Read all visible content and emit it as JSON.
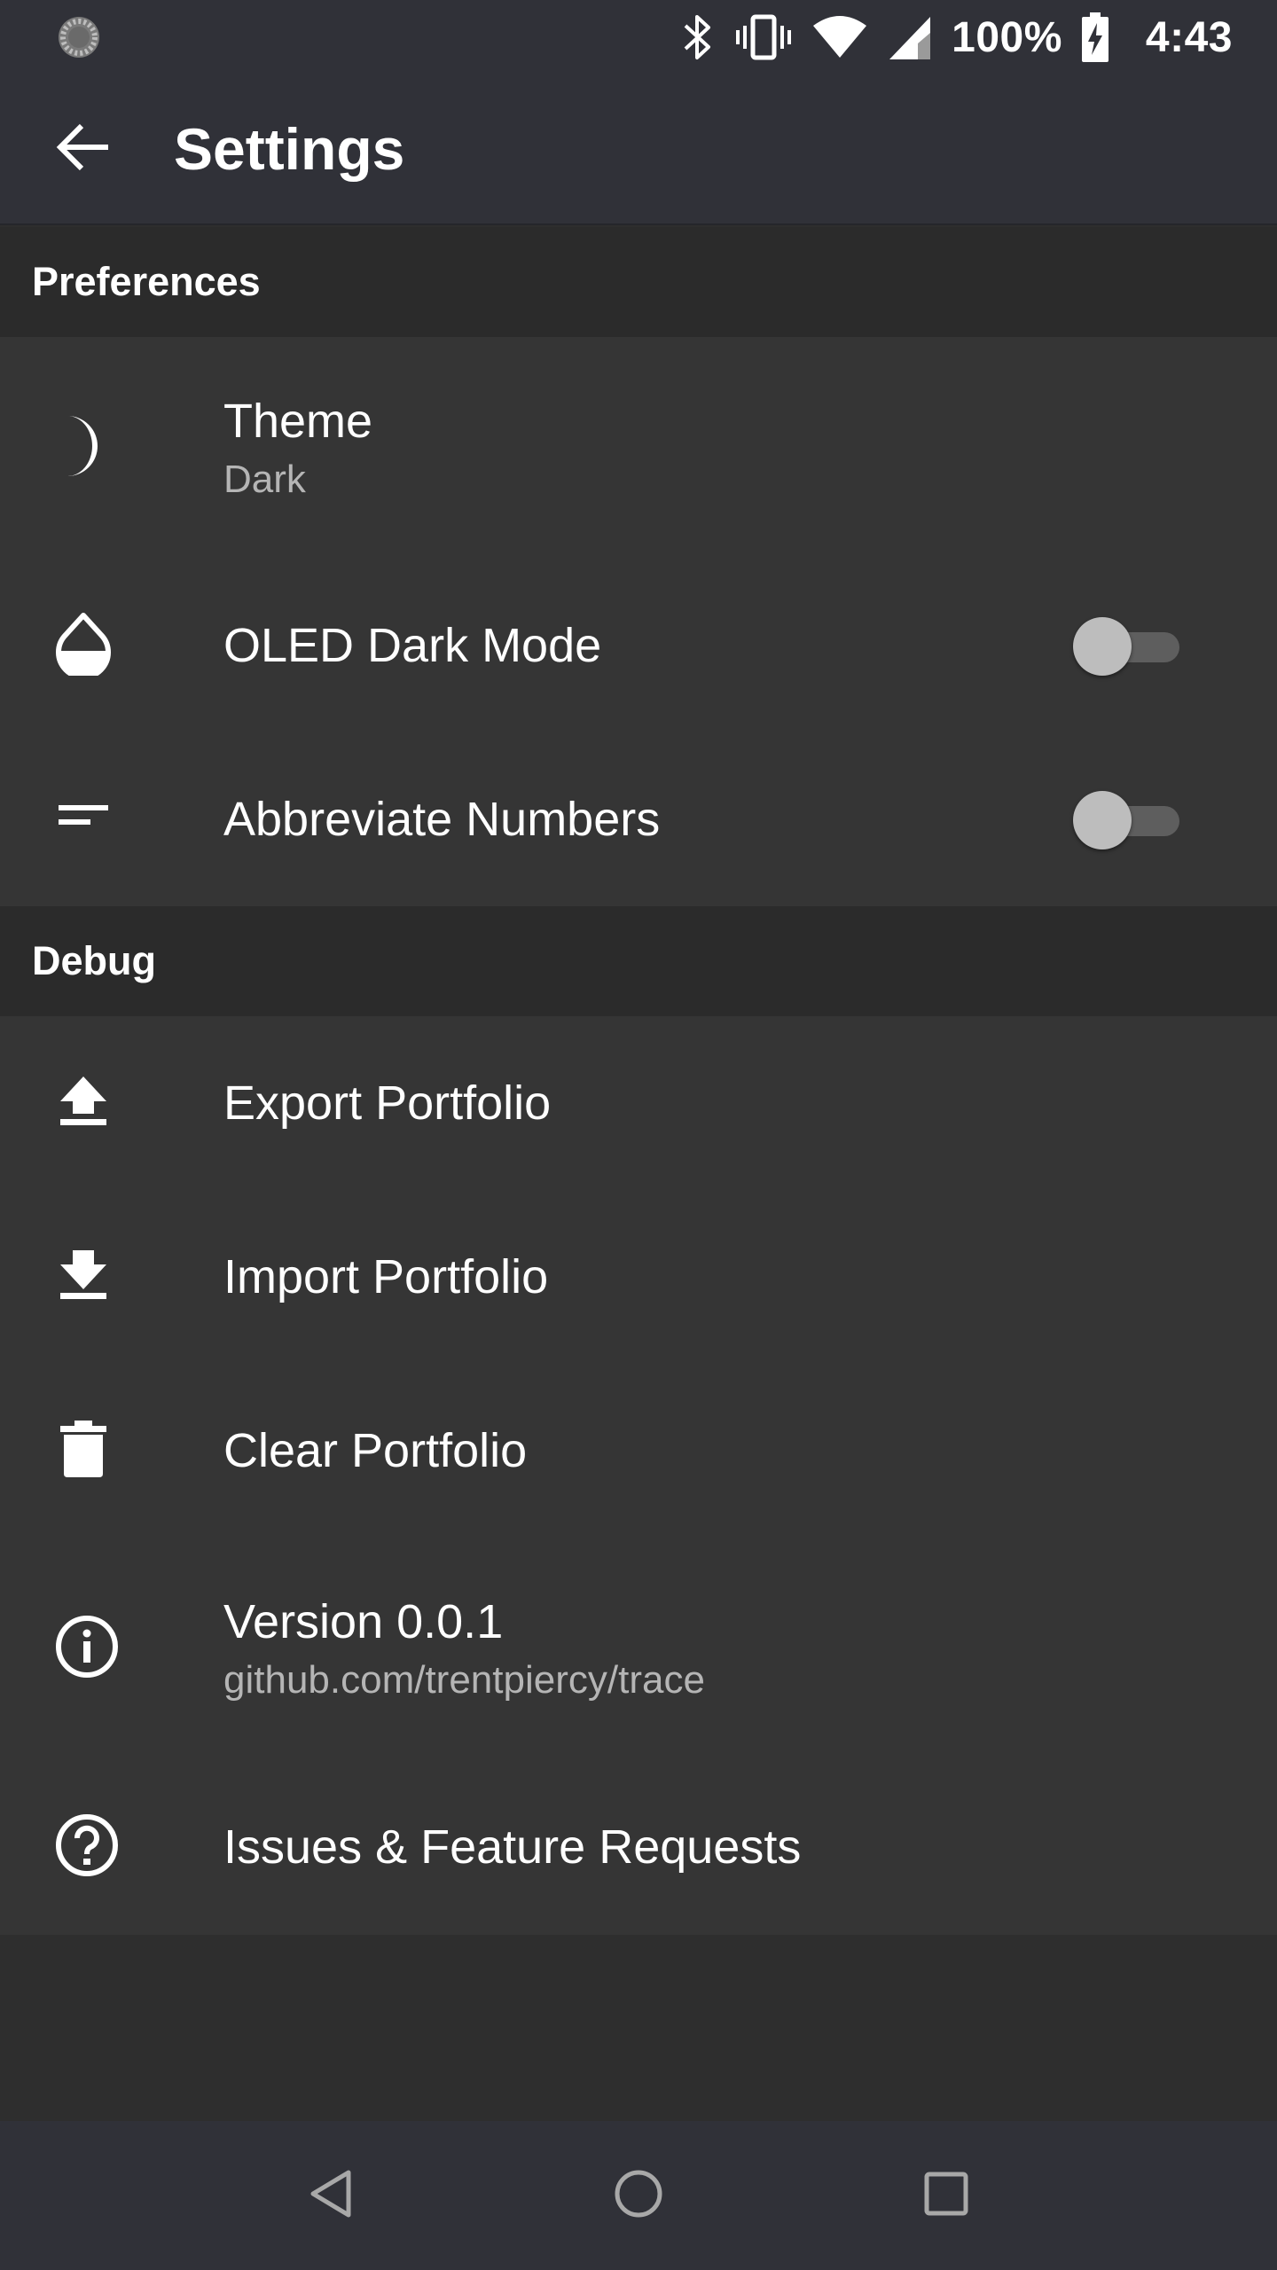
{
  "status_bar": {
    "battery": "100%",
    "time": "4:43",
    "icons": [
      "loading-icon",
      "bluetooth-icon",
      "vibrate-icon",
      "wifi-icon",
      "signal-icon",
      "battery-charging-icon"
    ]
  },
  "app_bar": {
    "title": "Settings",
    "back_icon": "arrow-back-icon"
  },
  "sections": {
    "preferences": {
      "title": "Preferences",
      "items": {
        "theme": {
          "label": "Theme",
          "value": "Dark",
          "icon": "moon-icon"
        },
        "oled": {
          "label": "OLED Dark Mode",
          "icon": "drop-icon",
          "enabled": false
        },
        "abbreviate": {
          "label": "Abbreviate Numbers",
          "icon": "short-text-icon",
          "enabled": false
        }
      }
    },
    "debug": {
      "title": "Debug",
      "items": {
        "export": {
          "label": "Export Portfolio",
          "icon": "upload-icon"
        },
        "import": {
          "label": "Import Portfolio",
          "icon": "download-icon"
        },
        "clear": {
          "label": "Clear Portfolio",
          "icon": "trash-icon"
        },
        "version": {
          "label": "Version 0.0.1",
          "value": "github.com/trentpiercy/trace",
          "icon": "info-icon"
        },
        "issues": {
          "label": "Issues & Feature Requests",
          "icon": "help-icon"
        }
      }
    }
  },
  "nav_bar": {
    "icons": [
      "nav-back-icon",
      "nav-home-icon",
      "nav-recents-icon"
    ]
  },
  "colors": {
    "bars": "#303138",
    "section_header": "#2b2b2b",
    "rows": "#353535",
    "background": "#2e2e2e",
    "secondary_text": "#b5b5b5"
  }
}
